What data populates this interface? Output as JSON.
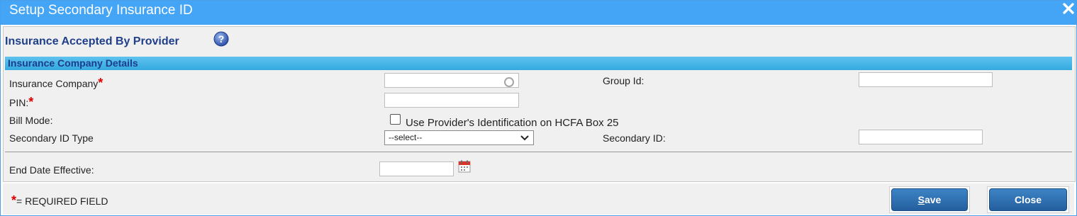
{
  "dialog": {
    "title": "Setup Secondary Insurance ID"
  },
  "section": {
    "title": "Insurance Accepted By Provider",
    "header": "Insurance Company Details"
  },
  "form": {
    "insurance_company_label": "Insurance Company",
    "insurance_company_value": "",
    "group_id_label": "Group Id:",
    "group_id_value": "",
    "pin_label": "PIN:",
    "pin_value": "",
    "bill_mode_label": "Bill Mode:",
    "bill_mode_checkbox_label": "Use Provider's Identification on HCFA Box 25",
    "bill_mode_checked": false,
    "secondary_id_type_label": "Secondary ID Type",
    "secondary_id_type_selected": "--select--",
    "secondary_id_label": "Secondary ID:",
    "secondary_id_value": "",
    "end_date_label": "End Date Effective:",
    "end_date_value": "",
    "required_marker": "*"
  },
  "footer": {
    "required_marker": "*",
    "required_text": "= REQUIRED FIELD",
    "save_label_underlined": "S",
    "save_label_rest": "ave",
    "close_label": "Close"
  },
  "colors": {
    "titlebar": "#44a4f5",
    "header_bar": "#34a9e0",
    "button": "#245f9e",
    "required": "#e00000"
  }
}
